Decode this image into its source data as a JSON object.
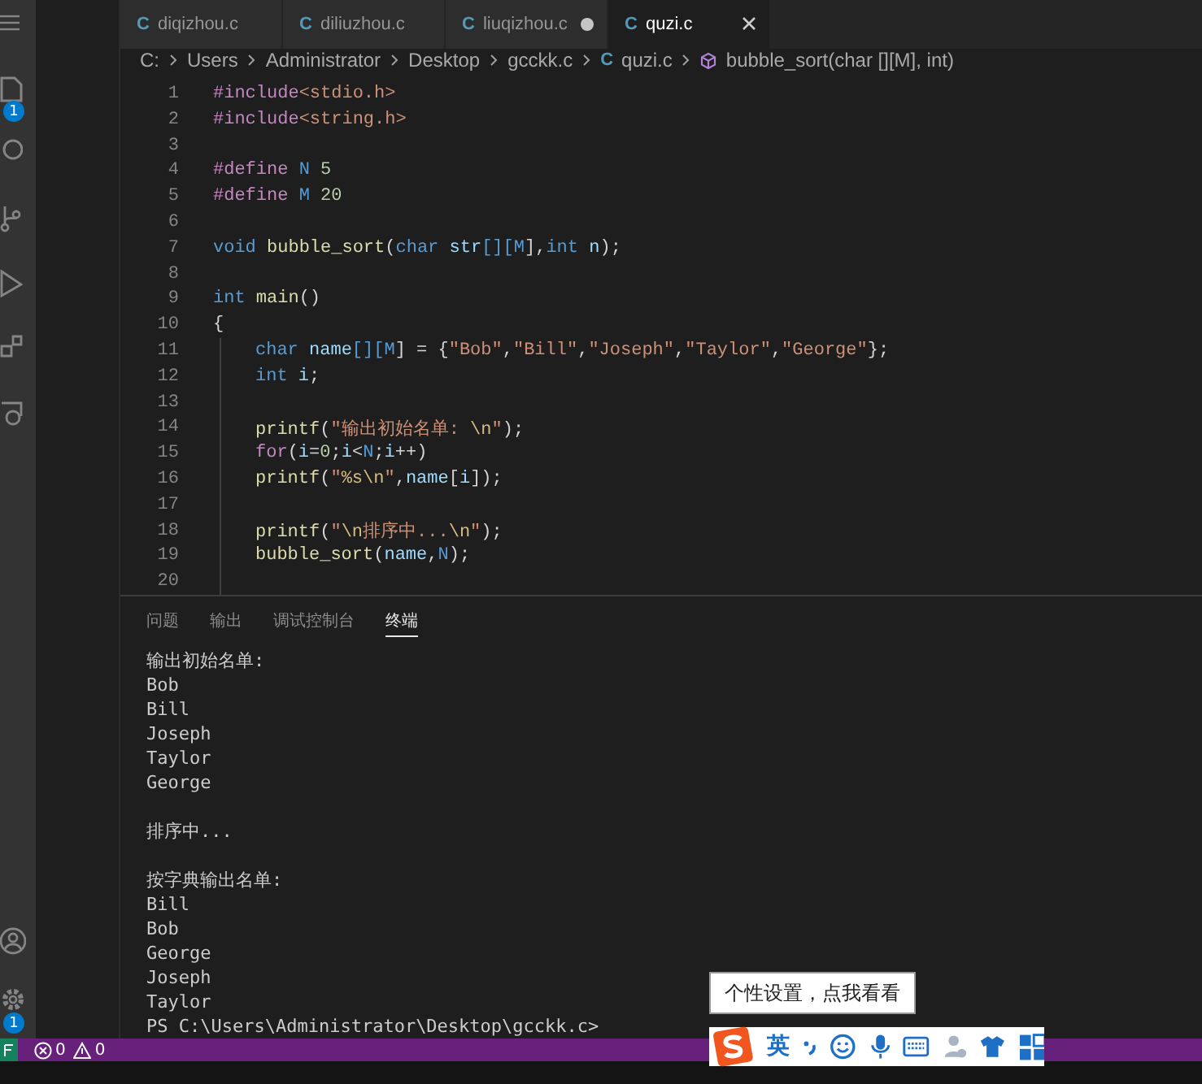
{
  "activity_bar": {
    "top": [
      {
        "kind": "menu"
      },
      {
        "kind": "files",
        "badge": "1"
      },
      {
        "kind": "search"
      },
      {
        "kind": "branch"
      },
      {
        "kind": "run"
      },
      {
        "kind": "extensions"
      },
      {
        "kind": "remote"
      }
    ],
    "bottom": [
      {
        "kind": "account"
      },
      {
        "kind": "gear",
        "badge": "1"
      }
    ]
  },
  "tabs": [
    {
      "icon": "C",
      "label": "diqizhou.c",
      "selected": false,
      "modified": false
    },
    {
      "icon": "C",
      "label": "diliuzhou.c",
      "selected": false,
      "modified": false
    },
    {
      "icon": "C",
      "label": "liuqizhou.c",
      "selected": false,
      "modified": true
    },
    {
      "icon": "C",
      "label": "quzi.c",
      "selected": true,
      "modified": false
    }
  ],
  "breadcrumbs": [
    {
      "label": "C:",
      "kind": "folder"
    },
    {
      "label": "Users",
      "kind": "folder"
    },
    {
      "label": "Administrator",
      "kind": "folder"
    },
    {
      "label": "Desktop",
      "kind": "folder"
    },
    {
      "label": "gcckk.c",
      "kind": "folder"
    },
    {
      "icon": "C",
      "label": "quzi.c",
      "kind": "file"
    },
    {
      "label": "bubble_sort(char [][M], int)",
      "kind": "symbol"
    }
  ],
  "code_lines": [
    {
      "number": "1",
      "tokens": [
        {
          "text": "#include",
          "kind": "pre"
        },
        {
          "text": "<stdio.h>",
          "kind": "str"
        }
      ]
    },
    {
      "number": "2",
      "tokens": [
        {
          "text": "#include",
          "kind": "pre"
        },
        {
          "text": "<string.h>",
          "kind": "str"
        }
      ]
    },
    {
      "number": "3"
    },
    {
      "number": "4",
      "tokens": [
        {
          "text": "#define ",
          "kind": "pre"
        },
        {
          "text": "N",
          "kind": "kw"
        },
        {
          "text": " 5",
          "kind": "num"
        }
      ]
    },
    {
      "number": "5",
      "tokens": [
        {
          "text": "#define ",
          "kind": "pre"
        },
        {
          "text": "M",
          "kind": "kw"
        },
        {
          "text": " 20",
          "kind": "num"
        }
      ]
    },
    {
      "number": "6"
    },
    {
      "number": "7",
      "tokens": [
        {
          "text": "void ",
          "kind": "kw"
        },
        {
          "text": "bubble_sort",
          "kind": "fn"
        },
        {
          "text": "(",
          "kind": "plain"
        },
        {
          "text": "char ",
          "kind": "kw"
        },
        {
          "text": "str",
          "kind": "var"
        },
        {
          "text": "[][",
          "kind": "kw"
        },
        {
          "text": "M",
          "kind": "kw"
        },
        {
          "text": "],",
          "kind": "plain"
        },
        {
          "text": "int ",
          "kind": "kw"
        },
        {
          "text": "n",
          "kind": "var"
        },
        {
          "text": ");",
          "kind": "plain"
        }
      ]
    },
    {
      "number": "8"
    },
    {
      "number": "9",
      "tokens": [
        {
          "text": "int ",
          "kind": "kw"
        },
        {
          "text": "main",
          "kind": "fn"
        },
        {
          "text": "()",
          "kind": "plain"
        }
      ]
    },
    {
      "number": "10",
      "tokens": [
        {
          "text": "{",
          "kind": "plain"
        }
      ],
      "children": [
        {
          "number": "11",
          "tokens": [
            {
              "text": "char ",
              "kind": "kw"
            },
            {
              "text": "name",
              "kind": "var"
            },
            {
              "text": "[][",
              "kind": "kw"
            },
            {
              "text": "M",
              "kind": "kw"
            },
            {
              "text": "] = {",
              "kind": "plain"
            },
            {
              "text": "\"Bob\"",
              "kind": "str"
            },
            {
              "text": ",",
              "kind": "plain"
            },
            {
              "text": "\"Bill\"",
              "kind": "str"
            },
            {
              "text": ",",
              "kind": "plain"
            },
            {
              "text": "\"Joseph\"",
              "kind": "str"
            },
            {
              "text": ",",
              "kind": "plain"
            },
            {
              "text": "\"Taylor\"",
              "kind": "str"
            },
            {
              "text": ",",
              "kind": "plain"
            },
            {
              "text": "\"George\"",
              "kind": "str"
            },
            {
              "text": "};",
              "kind": "plain"
            }
          ]
        },
        {
          "number": "12",
          "tokens": [
            {
              "text": "int ",
              "kind": "kw"
            },
            {
              "text": "i",
              "kind": "var"
            },
            {
              "text": ";",
              "kind": "plain"
            }
          ]
        },
        {
          "number": "13"
        },
        {
          "number": "14",
          "tokens": [
            {
              "text": "printf",
              "kind": "fn"
            },
            {
              "text": "(",
              "kind": "plain"
            },
            {
              "text": "\"输出初始名单: ",
              "kind": "str"
            },
            {
              "text": "\\n",
              "kind": "esc"
            },
            {
              "text": "\"",
              "kind": "str"
            },
            {
              "text": ");",
              "kind": "plain"
            }
          ]
        },
        {
          "number": "15",
          "tokens": [
            {
              "text": "for",
              "kind": "ctrl"
            },
            {
              "text": "(",
              "kind": "plain"
            },
            {
              "text": "i",
              "kind": "var"
            },
            {
              "text": "=",
              "kind": "plain"
            },
            {
              "text": "0",
              "kind": "num"
            },
            {
              "text": ";",
              "kind": "plain"
            },
            {
              "text": "i",
              "kind": "var"
            },
            {
              "text": "<",
              "kind": "plain"
            },
            {
              "text": "N",
              "kind": "kw"
            },
            {
              "text": ";",
              "kind": "plain"
            },
            {
              "text": "i",
              "kind": "var"
            },
            {
              "text": "++)",
              "kind": "plain"
            }
          ]
        },
        {
          "number": "16",
          "tokens": [
            {
              "text": "printf",
              "kind": "fn"
            },
            {
              "text": "(",
              "kind": "plain"
            },
            {
              "text": "\"",
              "kind": "str"
            },
            {
              "text": "%s\\n",
              "kind": "esc"
            },
            {
              "text": "\"",
              "kind": "str"
            },
            {
              "text": ",",
              "kind": "plain"
            },
            {
              "text": "name",
              "kind": "var"
            },
            {
              "text": "[",
              "kind": "plain"
            },
            {
              "text": "i",
              "kind": "var"
            },
            {
              "text": "]);",
              "kind": "plain"
            }
          ]
        },
        {
          "number": "17"
        },
        {
          "number": "18",
          "tokens": [
            {
              "text": "printf",
              "kind": "fn"
            },
            {
              "text": "(",
              "kind": "plain"
            },
            {
              "text": "\"",
              "kind": "str"
            },
            {
              "text": "\\n",
              "kind": "esc"
            },
            {
              "text": "排序中...",
              "kind": "str"
            },
            {
              "text": "\\n",
              "kind": "esc"
            },
            {
              "text": "\"",
              "kind": "str"
            },
            {
              "text": ");",
              "kind": "plain"
            }
          ]
        },
        {
          "number": "19",
          "tokens": [
            {
              "text": "bubble_sort",
              "kind": "fn"
            },
            {
              "text": "(",
              "kind": "plain"
            },
            {
              "text": "name",
              "kind": "var"
            },
            {
              "text": ",",
              "kind": "plain"
            },
            {
              "text": "N",
              "kind": "kw"
            },
            {
              "text": ");",
              "kind": "plain"
            }
          ]
        },
        {
          "number": "20"
        }
      ]
    }
  ],
  "panel_tabs": [
    {
      "label": "问题",
      "selected": false
    },
    {
      "label": "输出",
      "selected": false
    },
    {
      "label": "调试控制台",
      "selected": false
    },
    {
      "label": "终端",
      "selected": true
    }
  ],
  "terminal_blocks": [
    [
      "输出初始名单:",
      "Bob",
      "Bill",
      "Joseph",
      "Taylor",
      "George"
    ],
    [
      "排序中..."
    ],
    [
      "按字典输出名单:",
      "Bill",
      "Bob",
      "George",
      "Joseph",
      "Taylor",
      "PS C:\\Users\\Administrator\\Desktop\\gcckk.c>"
    ]
  ],
  "status_bar": {
    "errors": "0",
    "warnings": "0"
  },
  "ime": {
    "tooltip": "个性设置，点我看看",
    "language": "英",
    "tools": [
      {
        "kind": "punct"
      },
      {
        "kind": "smiley"
      },
      {
        "kind": "mic"
      },
      {
        "kind": "keyboard"
      },
      {
        "kind": "person",
        "disabled": true
      },
      {
        "kind": "shirt"
      },
      {
        "kind": "grid"
      }
    ]
  }
}
